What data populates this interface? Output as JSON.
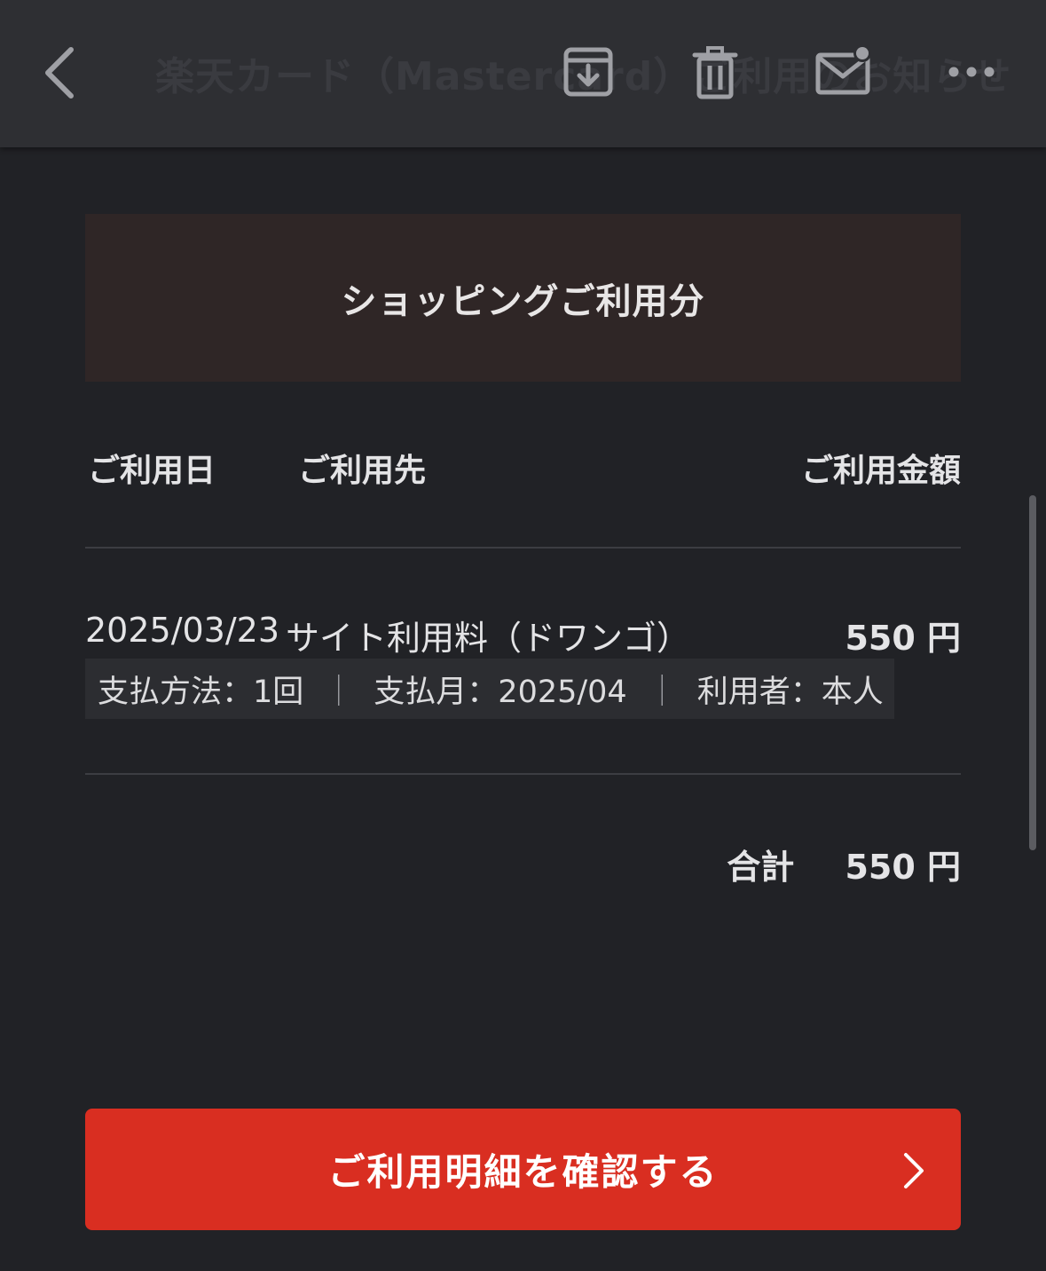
{
  "header": {
    "title": "楽天カード（Mastercard）ご利用のお知らせ",
    "icons": [
      "back-icon",
      "archive-icon",
      "trash-icon",
      "mail-unread-icon",
      "more-icon"
    ]
  },
  "section": {
    "title": "ショッピングご利用分"
  },
  "table": {
    "columns": {
      "date": "ご利用日",
      "merchant": "ご利用先",
      "amount": "ご利用金額"
    },
    "rows": [
      {
        "date": "2025/03/23",
        "merchant": "サイト利用料（ドワンゴ）",
        "amount": "550 円",
        "payment_method": "支払方法：1回",
        "payment_month": "支払月：2025/04",
        "user": "利用者：本人",
        "separator": "｜"
      }
    ]
  },
  "total": {
    "label": "合計",
    "amount": "550 円"
  },
  "cta": {
    "label": "ご利用明細を確認する",
    "color": "#d92e21"
  },
  "colors": {
    "background": "#212226",
    "topbar": "#2e2f33",
    "section_header": "#2f2626"
  }
}
